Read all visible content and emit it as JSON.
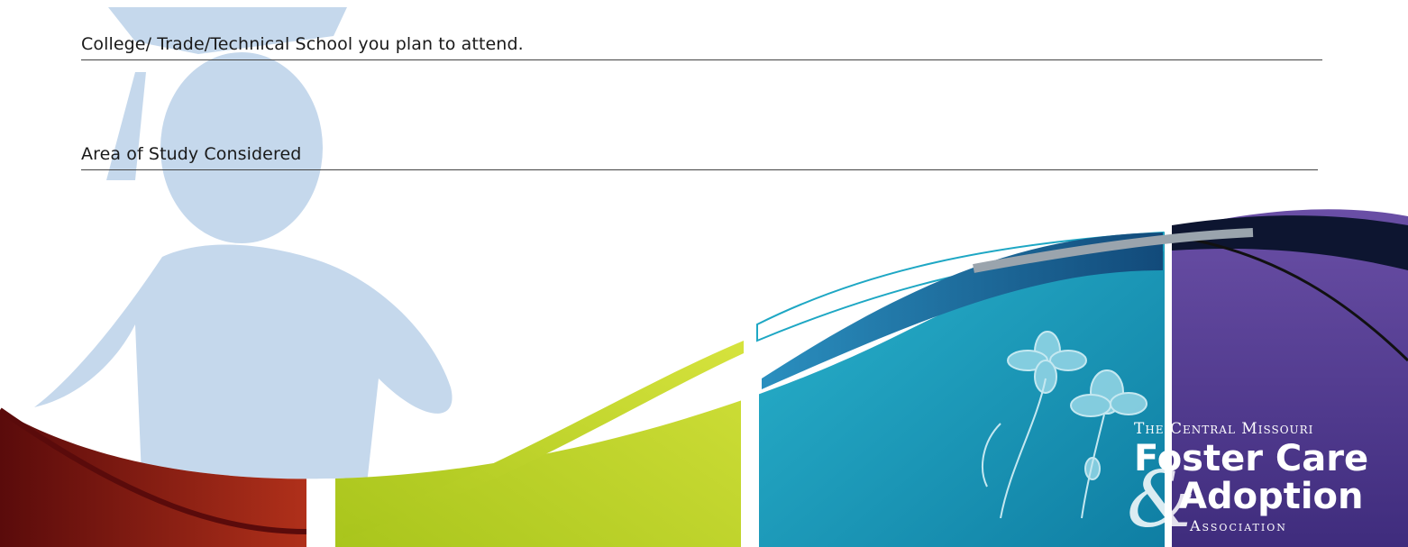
{
  "form": {
    "fields": [
      {
        "label": "College/ Trade/Technical School you plan to attend."
      },
      {
        "label": "Area of Study Considered"
      }
    ]
  },
  "logo": {
    "line1": "The Central Missouri",
    "line2": "Foster Care",
    "ampersand": "&",
    "line3": "Adoption",
    "line4": "Association"
  },
  "colors": {
    "graduate_silhouette": "#c5d8ec",
    "lime": "#c7d92a",
    "teal": "#1ea7c4",
    "blue": "#1a5e8c",
    "purple": "#5b3f98",
    "red": "#8a1414"
  }
}
